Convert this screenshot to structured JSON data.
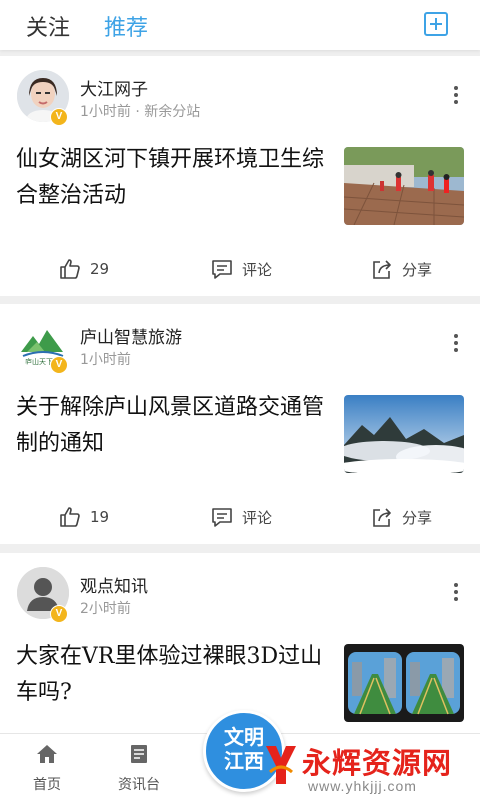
{
  "header": {
    "tabs": [
      {
        "label": "关注",
        "active": false
      },
      {
        "label": "推荐",
        "active": true
      }
    ],
    "add_icon": "plus-square-icon",
    "accent_color": "#3ea3e6"
  },
  "feed": [
    {
      "author": "大江网子",
      "meta": "1小时前 · 新余分站",
      "verified": "V",
      "title": "仙女湖区河下镇开展环境卫生综合整治活动",
      "likes": "29",
      "comment_label": "评论",
      "share_label": "分享",
      "avatar_icon": "person-photo-avatar",
      "thumb_icon": "street-cleaning-photo"
    },
    {
      "author": "庐山智慧旅游",
      "meta": "1小时前",
      "verified": "V",
      "title": "关于解除庐山风景区道路交通管制的通知",
      "likes": "19",
      "comment_label": "评论",
      "share_label": "分享",
      "avatar_icon": "mountain-logo-avatar",
      "thumb_icon": "mountain-fog-photo"
    },
    {
      "author": "观点知讯",
      "meta": "2小时前",
      "verified": "V",
      "title": "大家在VR里体验过裸眼3D过山车吗?",
      "avatar_icon": "default-user-avatar",
      "thumb_icon": "vr-rollercoaster-photo"
    }
  ],
  "bottom_nav": {
    "items": [
      {
        "label": "首页",
        "icon": "home-icon"
      },
      {
        "label": "资讯台",
        "icon": "news-icon"
      }
    ],
    "center_logo": {
      "line1": "文明",
      "line2": "江西"
    }
  },
  "watermark": {
    "text": "永辉资源网",
    "url": "www.yhkjjj.com",
    "color": "#e5231b"
  }
}
